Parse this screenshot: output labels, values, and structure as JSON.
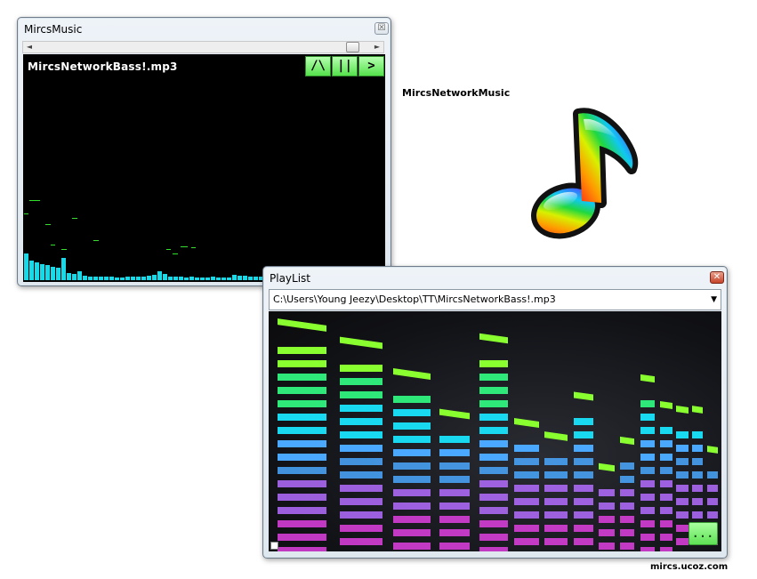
{
  "music_window": {
    "title": "MircsMusic",
    "close_glyph": "☒",
    "scroll_left_glyph": "◄",
    "scroll_right_glyph": "►",
    "track_title": "MircsNetworkBass!.mp3",
    "controls": {
      "stop_label": "/\\",
      "pause_label": "||",
      "play_label": ">"
    },
    "spectrum_bar_color": "#18d9e8",
    "spectrum_peak_color": "#31e02b"
  },
  "app_label": "MircsNetworkMusic",
  "music_note_icon": "music-note-icon",
  "playlist_window": {
    "title": "PlayList",
    "close_glyph": "✕",
    "current_path": "C:\\Users\\Young Jeezy\\Desktop\\TT\\MircsNetworkBass!.mp3",
    "dropdown_glyph": "▼",
    "more_button_label": "...",
    "eq_colors": [
      "#e040e0",
      "#b46cff",
      "#4aa8ff",
      "#18d9f0",
      "#2ee87a",
      "#8aff30"
    ]
  },
  "site_credit": "mircs.ucoz.com"
}
